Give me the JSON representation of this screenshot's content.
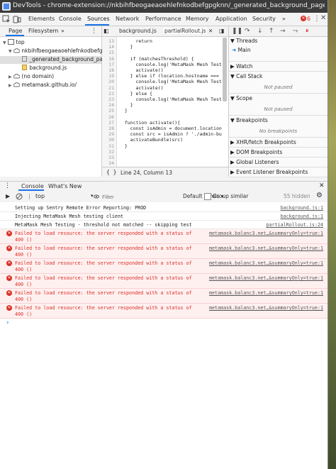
{
  "window": {
    "title": "DevTools - chrome-extension://nkbihfbeogaeaoehlefnkodbefgpgknn/_generated_background_page.h..."
  },
  "toptabs": [
    "Elements",
    "Console",
    "Sources",
    "Network",
    "Performance",
    "Memory",
    "Application",
    "Security"
  ],
  "active_toptab": "Sources",
  "overflow_label": "»",
  "error_count": "6",
  "navigator": {
    "tabs": [
      "Page",
      "Filesystem"
    ],
    "more": "»",
    "tree": [
      {
        "label": "top"
      },
      {
        "label": "nkbihfbeogaeaoehlefnkodbefgpgknn"
      },
      {
        "label": "_generated_background_page.html"
      },
      {
        "label": "background.js"
      },
      {
        "label": "(no domain)"
      },
      {
        "label": "metamask.github.io/"
      }
    ]
  },
  "editor": {
    "tabs": [
      "background.js",
      "partialRollout.js"
    ],
    "line_numbers": [
      "13",
      "14",
      "15",
      "16",
      "17",
      "18",
      "19",
      "20",
      "21",
      "22",
      "23",
      "24",
      "25",
      "26",
      "27",
      "28",
      "29",
      "30",
      "31",
      "32",
      "33",
      "34"
    ],
    "lines": [
      "      return",
      "    }",
      "",
      "    if (matchesThreshold) {",
      "      console.log('MetaMask Mesh Test",
      "      activate()",
      "    } else if (location.hostname ===",
      "      console.log('MetaMask Mesh Test",
      "      activate()",
      "    } else {",
      "      console.log('MetaMask Mesh Test",
      "    }",
      "  }",
      "",
      "  function activate(){",
      "    const isAdmin = document.location",
      "    const src = isAdmin ? './admin-bu",
      "    activateBundle(src)",
      "  }",
      "",
      "",
      ""
    ],
    "status": "Line 24, Column 13",
    "format_icon": "{ }"
  },
  "debugger": {
    "threads_label": "Threads",
    "main_thread": "Main",
    "watch_label": "Watch",
    "callstack_label": "Call Stack",
    "callstack_empty": "Not paused",
    "scope_label": "Scope",
    "scope_empty": "Not paused",
    "breakpoints_label": "Breakpoints",
    "breakpoints_empty": "No breakpoints",
    "xhr_label": "XHR/fetch Breakpoints",
    "dom_label": "DOM Breakpoints",
    "global_label": "Global Listeners",
    "event_label": "Event Listener Breakpoints"
  },
  "console": {
    "tabs": [
      "Console",
      "What's New"
    ],
    "context": "top",
    "filter_placeholder": "Filter",
    "levels": "Default levels ▾",
    "group_similar": "Group similar",
    "hidden": "55 hidden",
    "messages": [
      {
        "type": "log",
        "text": "Setting up Sentry Remote Error Reporting: PROD",
        "text2": "",
        "source": "background.js:1"
      },
      {
        "type": "log",
        "text": "Injecting MetaMask Mesh testing client",
        "text2": "",
        "source": "background.js:1"
      },
      {
        "type": "log",
        "text": "MetaMask Mesh Testing - threshold not matched -- skipping test",
        "text2": "",
        "source": "partialRollout.js:24"
      },
      {
        "type": "error",
        "text": "Failed to load resource: the server responded with a status of",
        "text2": "400 ()",
        "source": "metamask.balanc3.net…&summaryOnly=true:1"
      },
      {
        "type": "error",
        "text": "Failed to load resource: the server responded with a status of",
        "text2": "400 ()",
        "source": "metamask.balanc3.net…&summaryOnly=true:1"
      },
      {
        "type": "error",
        "text": "Failed to load resource: the server responded with a status of",
        "text2": "400 ()",
        "source": "metamask.balanc3.net…&summaryOnly=true:1"
      },
      {
        "type": "error",
        "text": "Failed to load resource: the server responded with a status of",
        "text2": "400 ()",
        "source": "metamask.balanc3.net…&summaryOnly=true:1"
      },
      {
        "type": "error",
        "text": "Failed to load resource: the server responded with a status of",
        "text2": "400 ()",
        "source": "metamask.balanc3.net…&summaryOnly=true:1"
      },
      {
        "type": "error",
        "text": "Failed to load resource: the server responded with a status of",
        "text2": "400 ()",
        "source": "metamask.balanc3.net…&summaryOnly=true:1"
      }
    ],
    "prompt": "›"
  },
  "colors": {
    "accent": "#1a73e8",
    "error": "#d93025",
    "error_bg": "#fff0f0"
  }
}
